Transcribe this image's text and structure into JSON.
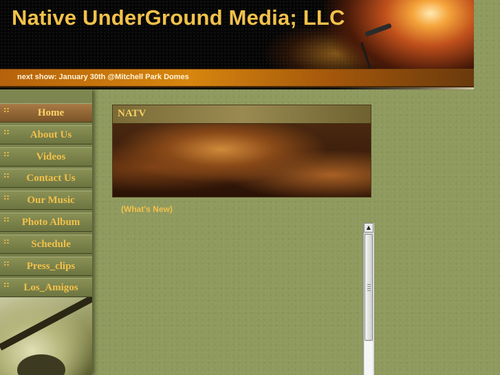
{
  "header": {
    "title": "Native UnderGround Media; LLC",
    "next_show": "next show:  January 30th @Mitchell Park Domes"
  },
  "sidebar": {
    "items": [
      {
        "label": "Home",
        "active": true
      },
      {
        "label": "About Us",
        "active": false
      },
      {
        "label": "Videos",
        "active": false
      },
      {
        "label": "Contact Us",
        "active": false
      },
      {
        "label": "Our Music",
        "active": false
      },
      {
        "label": "Photo Album",
        "active": false
      },
      {
        "label": "Schedule",
        "active": false
      },
      {
        "label": "Press_clips",
        "active": false
      },
      {
        "label": "Los_Amigos",
        "active": false
      }
    ],
    "bullet": "::"
  },
  "main": {
    "panel_title": "NATV",
    "whats_new_link": "(What's New)"
  },
  "scrollbar": {
    "up_arrow": "▲"
  },
  "colors": {
    "accent_gold": "#f2c14a",
    "background_olive": "#8f9a5e",
    "show_bar_orange": "#d7860f"
  }
}
